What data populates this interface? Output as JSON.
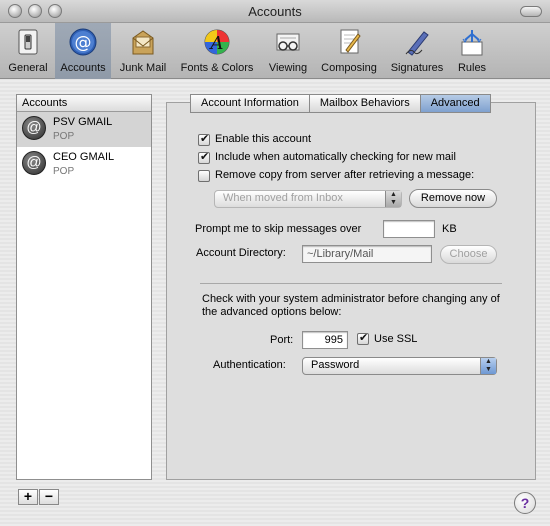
{
  "window": {
    "title": "Accounts"
  },
  "toolbar": {
    "items": [
      {
        "label": "General",
        "icon": "switch-icon"
      },
      {
        "label": "Accounts",
        "icon": "at-sign-icon"
      },
      {
        "label": "Junk Mail",
        "icon": "junk-mail-icon"
      },
      {
        "label": "Fonts & Colors",
        "icon": "color-wheel-icon"
      },
      {
        "label": "Viewing",
        "icon": "glasses-icon"
      },
      {
        "label": "Composing",
        "icon": "compose-icon"
      },
      {
        "label": "Signatures",
        "icon": "pen-icon"
      },
      {
        "label": "Rules",
        "icon": "rules-icon"
      }
    ],
    "selected": "Accounts"
  },
  "sidebar": {
    "header": "Accounts",
    "accounts": [
      {
        "name": "PSV GMAIL",
        "type": "POP",
        "selected": true
      },
      {
        "name": "CEO GMAIL",
        "type": "POP",
        "selected": false
      }
    ],
    "add_label": "+",
    "remove_label": "−"
  },
  "tabs": [
    {
      "label": "Account Information",
      "active": false
    },
    {
      "label": "Mailbox Behaviors",
      "active": false
    },
    {
      "label": "Advanced",
      "active": true
    }
  ],
  "advanced": {
    "enable_account": {
      "label": "Enable this account",
      "checked": true
    },
    "include_check": {
      "label": "Include when automatically checking for new mail",
      "checked": true
    },
    "remove_copy": {
      "label": "Remove copy from server after retrieving a message:",
      "checked": false
    },
    "remove_when": "When moved from Inbox",
    "remove_now_label": "Remove now",
    "skip_label": "Prompt me to skip messages over",
    "skip_value": "",
    "skip_unit": "KB",
    "dir_label": "Account Directory:",
    "dir_value": "~/Library/Mail",
    "choose_label": "Choose",
    "admin_note_1": "Check with your system administrator before changing any of",
    "admin_note_2": "the advanced options below:",
    "port_label": "Port:",
    "port_value": "995",
    "ssl": {
      "label": "Use SSL",
      "checked": true
    },
    "auth_label": "Authentication:",
    "auth_value": "Password"
  },
  "help_label": "?"
}
